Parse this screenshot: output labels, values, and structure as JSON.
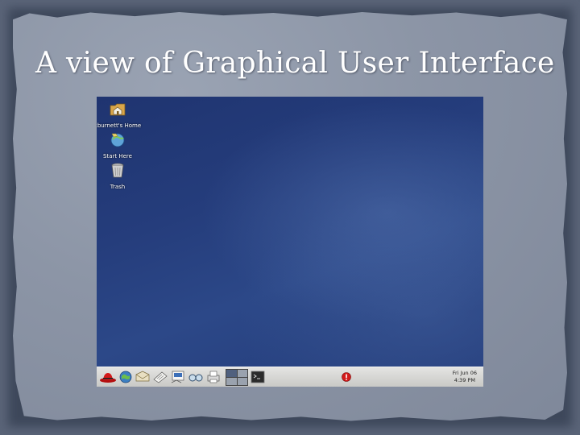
{
  "slide": {
    "title": "A view of Graphical User Interface"
  },
  "desktop": {
    "icons": [
      {
        "label": "kburnett's Home",
        "icon": "home-folder-icon"
      },
      {
        "label": "Start Here",
        "icon": "start-here-icon"
      },
      {
        "label": "Trash",
        "icon": "trash-icon"
      }
    ]
  },
  "taskbar": {
    "launchers": [
      "red-hat-menu-icon",
      "web-browser-icon",
      "email-icon",
      "text-editor-icon",
      "presentation-icon",
      "image-viewer-icon",
      "print-manager-icon"
    ],
    "workspaces": [
      "workspace-1",
      "workspace-2",
      "workspace-3",
      "workspace-4"
    ],
    "terminal": "terminal-icon",
    "alert": "update-alert-icon",
    "clock": {
      "date": "Fri Jun 06",
      "time": "4:39 PM"
    }
  },
  "colors": {
    "desktop_blue": "#253d7c",
    "taskbar": "#d6d6d3",
    "alert_red": "#d31a1a"
  }
}
